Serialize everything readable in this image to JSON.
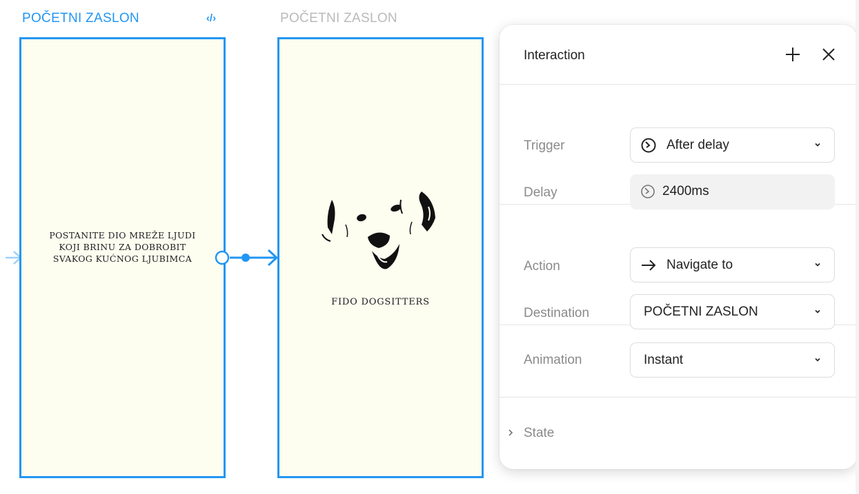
{
  "canvas": {
    "frame1_title": "POČETNI ZASLON",
    "frame2_title": "POČETNI ZASLON",
    "frame1_text": "POSTANITE DIO MREŽE LJUDI KOJI BRINU ZA DOBROBIT SVAKOG KUĆNOG LJUBIMCA",
    "brand_name": "FIDO DOGSITTERS",
    "code_icon_glyph": "‹/›",
    "accent": "#2196f3"
  },
  "panel": {
    "title": "Interaction",
    "trigger_label": "Trigger",
    "trigger_value": "After delay",
    "delay_label": "Delay",
    "delay_value": "2400ms",
    "action_label": "Action",
    "action_value": "Navigate to",
    "destination_label": "Destination",
    "destination_value": "POČETNI ZASLON",
    "animation_label": "Animation",
    "animation_value": "Instant",
    "state_label": "State"
  },
  "icons": {
    "add": "plus-icon",
    "close": "close-icon",
    "timer": "timer-icon",
    "arrow": "arrow-right-icon",
    "chevron": "chevron-down-icon"
  }
}
